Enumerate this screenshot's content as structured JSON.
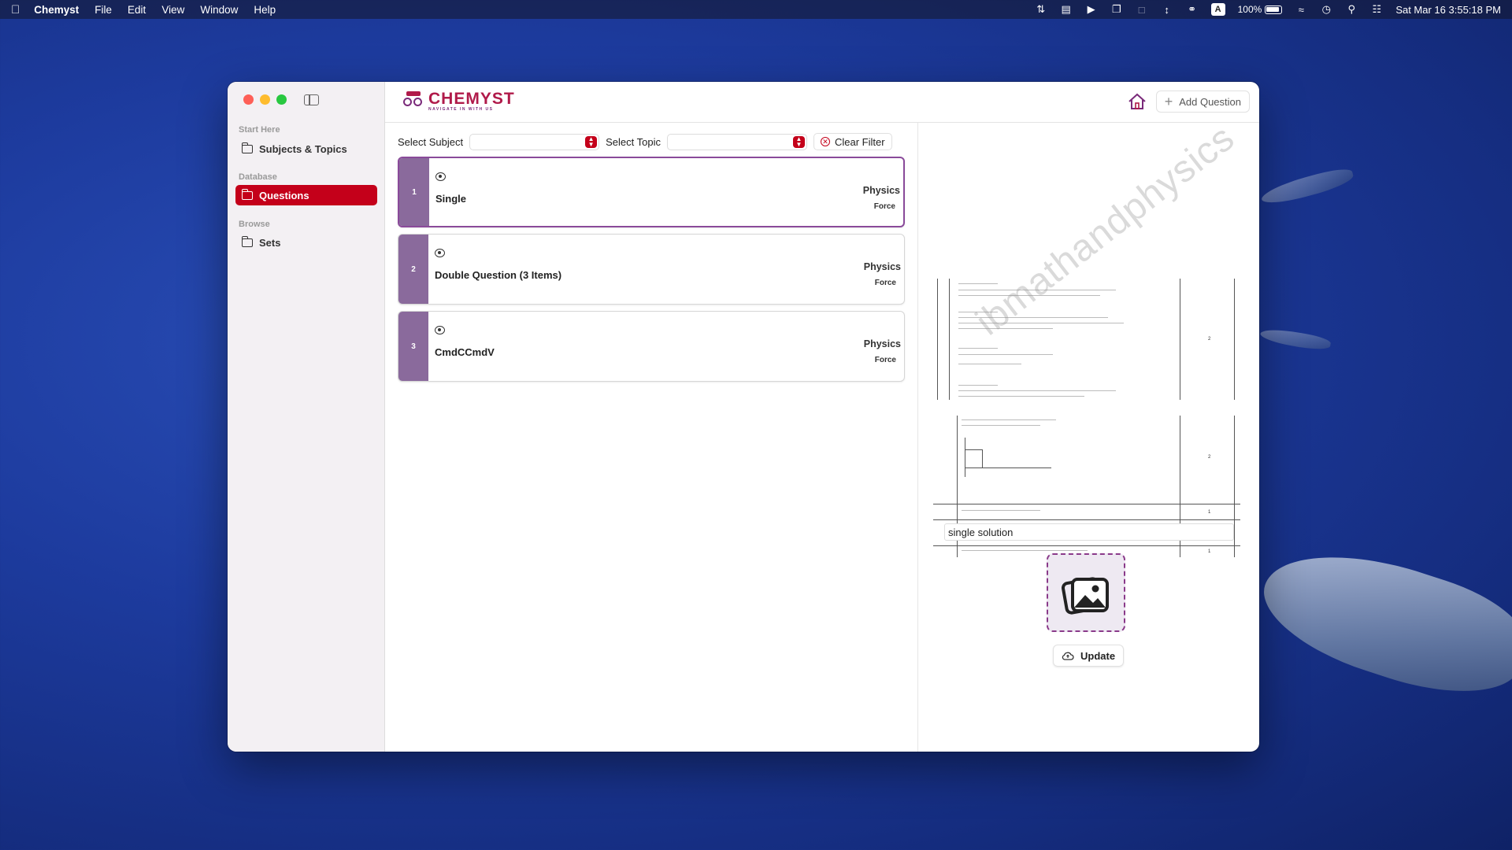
{
  "menubar": {
    "app_name": "Chemyst",
    "items": [
      "File",
      "Edit",
      "View",
      "Window",
      "Help"
    ],
    "input_indicator": "A",
    "battery": "100%",
    "datetime": "Sat Mar 16  3:55:18 PM"
  },
  "sidebar": {
    "sections": [
      {
        "label": "Start Here",
        "item": "Subjects & Topics"
      },
      {
        "label": "Database",
        "item": "Questions"
      },
      {
        "label": "Browse",
        "item": "Sets"
      }
    ]
  },
  "toolbar": {
    "logo_text": "CHEMYST",
    "logo_tagline": "NAVIGATE IN WITH US",
    "add_question_label": "Add Question"
  },
  "filters": {
    "subject_label": "Select Subject",
    "subject_value": "",
    "topic_label": "Select Topic",
    "topic_value": "",
    "clear_label": "Clear Filter"
  },
  "questions": [
    {
      "number": "1",
      "title": "Single",
      "subject": "Physics",
      "topic": "Force"
    },
    {
      "number": "2",
      "title": "Double Question (3 Items)",
      "subject": "Physics",
      "topic": "Force"
    },
    {
      "number": "3",
      "title": "CmdCCmdV",
      "subject": "Physics",
      "topic": "Force"
    }
  ],
  "preview": {
    "watermark": "ibmathandphysics"
  },
  "editor": {
    "solution_value": "single solution",
    "update_label": "Update"
  },
  "colors": {
    "accent": "#c4001a",
    "brand": "#b01a4a",
    "card_number_bg": "#8a6a9c"
  }
}
